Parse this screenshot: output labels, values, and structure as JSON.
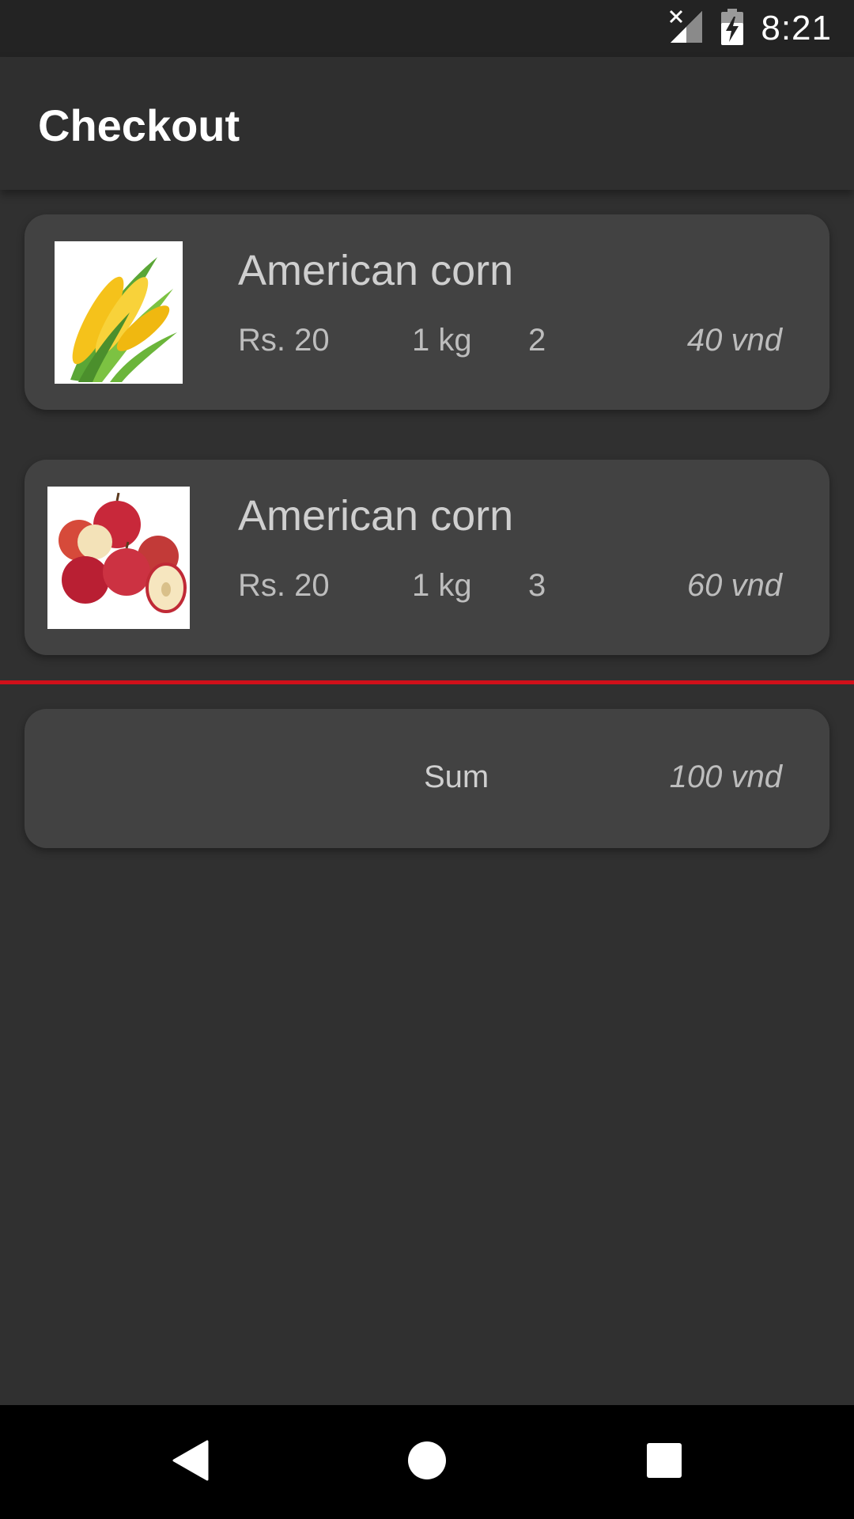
{
  "status_bar": {
    "time": "8:21",
    "icons": [
      "signal-off-icon",
      "battery-charging-icon"
    ]
  },
  "app_bar": {
    "title": "Checkout"
  },
  "cart": {
    "items": [
      {
        "name": "American corn",
        "price": "Rs. 20",
        "unit": "1 kg",
        "quantity": "2",
        "total": "40 vnd",
        "image": "corn-image"
      },
      {
        "name": "American corn",
        "price": "Rs. 20",
        "unit": "1 kg",
        "quantity": "3",
        "total": "60 vnd",
        "image": "apples-image"
      }
    ],
    "divider_color": "#d0101a"
  },
  "summary": {
    "label": "Sum",
    "value": "100 vnd"
  },
  "nav_bar": {
    "icons": [
      "back-icon",
      "home-icon",
      "recents-icon"
    ]
  },
  "colors": {
    "background": "#303030",
    "card": "#424242",
    "status_bar": "#232323",
    "nav_bar": "#000000"
  }
}
